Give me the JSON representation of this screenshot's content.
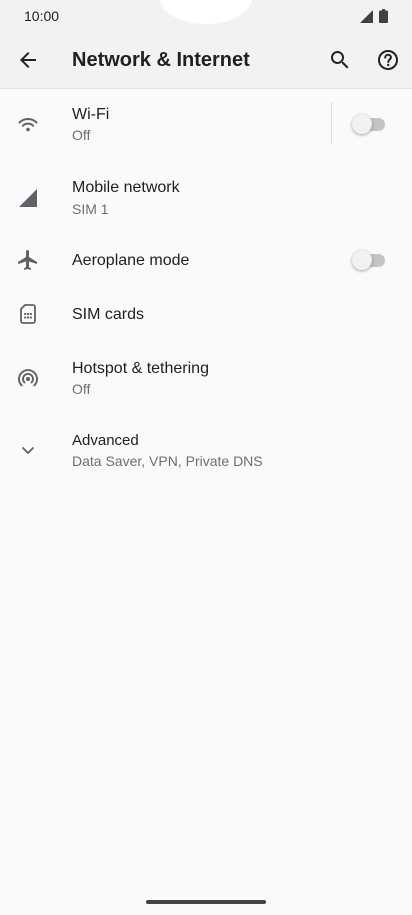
{
  "status_bar": {
    "time": "10:00",
    "signal_icon": "cell-signal-icon",
    "battery_icon": "battery-icon"
  },
  "app_bar": {
    "title": "Network & Internet",
    "back_icon": "arrow-back-icon",
    "search_icon": "search-icon",
    "help_icon": "help-icon"
  },
  "settings": {
    "wifi": {
      "title": "Wi-Fi",
      "subtitle": "Off",
      "icon": "wifi-icon",
      "toggle_on": false
    },
    "mobile_network": {
      "title": "Mobile network",
      "subtitle": "SIM 1",
      "icon": "cell-signal-icon"
    },
    "aeroplane_mode": {
      "title": "Aeroplane mode",
      "icon": "airplane-icon",
      "toggle_on": false
    },
    "sim_cards": {
      "title": "SIM cards",
      "icon": "sim-card-icon"
    },
    "hotspot": {
      "title": "Hotspot & tethering",
      "subtitle": "Off",
      "icon": "hotspot-icon"
    },
    "advanced": {
      "title": "Advanced",
      "subtitle": "Data Saver, VPN, Private DNS",
      "icon": "chevron-down-icon"
    }
  },
  "colors": {
    "background": "#fafafa",
    "app_bar": "#f2f2f2",
    "icon": "#5f6368",
    "text": "#202124",
    "secondary_text": "#6f6f6f"
  }
}
